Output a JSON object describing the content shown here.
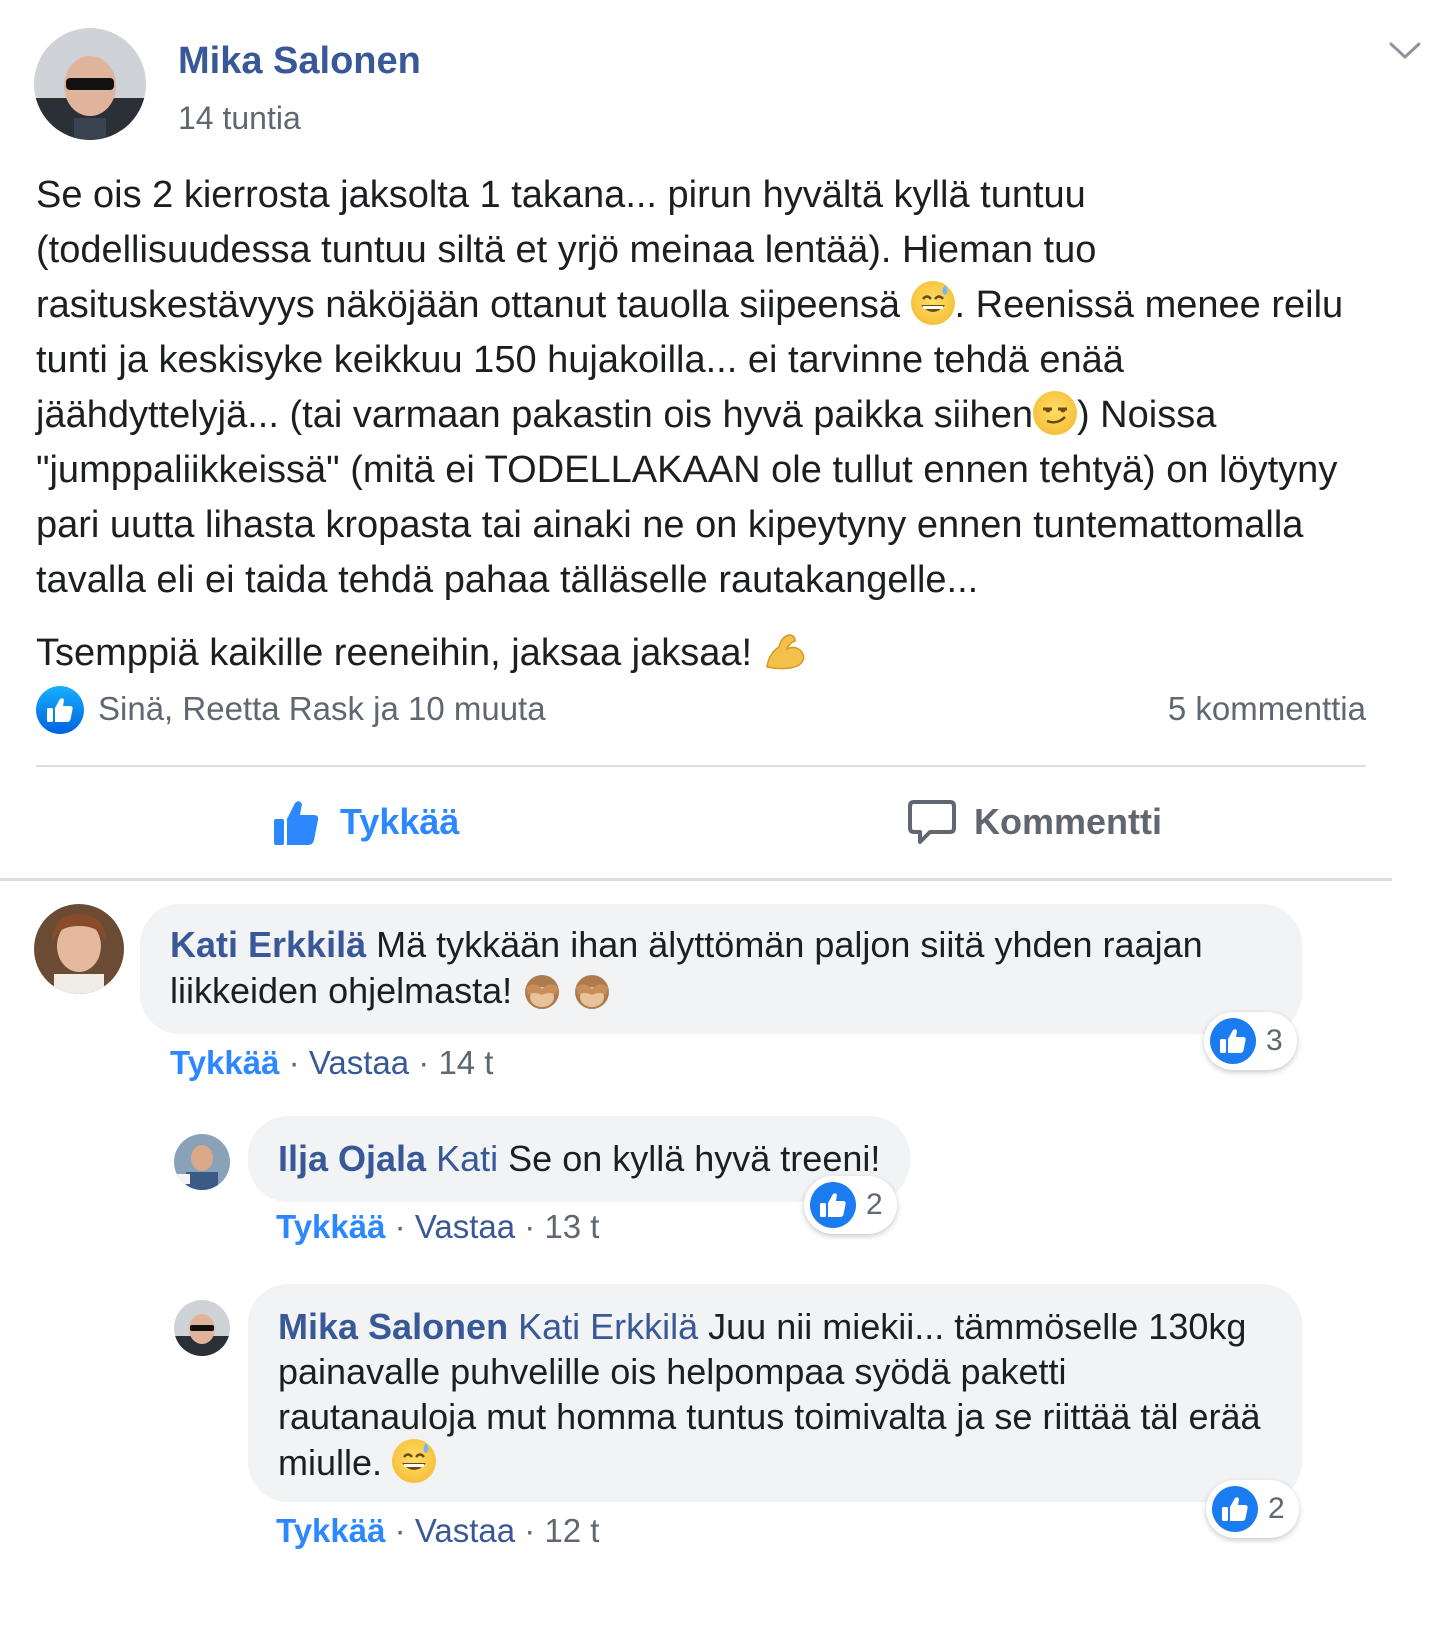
{
  "post": {
    "author": "Mika Salonen",
    "time": "14 tuntia",
    "paragraph1_a": "Se ois 2 kierrosta jaksolta 1 takana... pirun hyvältä kyllä tuntuu (todellisuudessa tuntuu siltä et yrjö meinaa lentää). Hieman tuo rasituskestävyys näköjään ottanut tauolla siipeensä ",
    "paragraph1_b": ". Reenissä menee reilu tunti ja keskisyke keikkuu 150 hujakoilla... ei tarvinne tehdä enää jäähdyttelyjä... (tai varmaan pakastin ois hyvä paikka siihen",
    "paragraph1_c": ") Noissa \"jumppaliikkeissä\" (mitä ei TODELLAKAAN ole tullut ennen tehtyä) on löytyny pari uutta lihasta kropasta tai ainaki ne on kipeytyny ennen tuntemattomalla tavalla eli ei taida tehdä pahaa tälläselle rautakangelle...",
    "paragraph2": "Tsemppiä kaikille reeneihin, jaksaa jaksaa! ",
    "reactions_text": "Sinä, Reetta Rask ja 10 muuta",
    "comments_count": "5 kommenttia",
    "like_label": "Tykkää",
    "comment_label": "Kommentti"
  },
  "comments": [
    {
      "author": "Kati Erkkilä",
      "mention": "",
      "text": "Mä tykkään ihan älyttömän paljon siitä yhden raajan liikkeiden ohjelmasta! ",
      "like": "Tykkää",
      "reply": "Vastaa",
      "time": "14 t",
      "reactions": "3"
    },
    {
      "author": "Ilja Ojala",
      "mention": "Kati",
      "text": "Se on kyllä hyvä treeni!",
      "like": "Tykkää",
      "reply": "Vastaa",
      "time": "13 t",
      "reactions": "2"
    },
    {
      "author": "Mika Salonen",
      "mention": "Kati Erkkilä",
      "text": "Juu nii miekii... tämmöselle 130kg painavalle puhvelille ois helpompaa syödä paketti rautanauloja mut homma tuntus toimivalta ja se riittää täl erää miulle. ",
      "like": "Tykkää",
      "reply": "Vastaa",
      "time": "12 t",
      "reactions": "2"
    }
  ],
  "separator": " · ",
  "colors": {
    "accent_blue": "#2d88ff",
    "name_blue": "#385898",
    "secondary_text": "#606770",
    "bubble_bg": "#f2f3f5",
    "divider": "#dadde1"
  },
  "icons": {
    "chevron": "chevron-down-icon",
    "like_badge": "like-badge-icon",
    "like_action": "thumbs-up-icon",
    "comment_action": "speech-bubble-icon",
    "emoji_sweat": "grinning-sweat-emoji",
    "emoji_smirk": "smirk-emoji",
    "emoji_muscle": "flexed-biceps-emoji",
    "emoji_monkey": "see-no-evil-monkey-emoji"
  }
}
